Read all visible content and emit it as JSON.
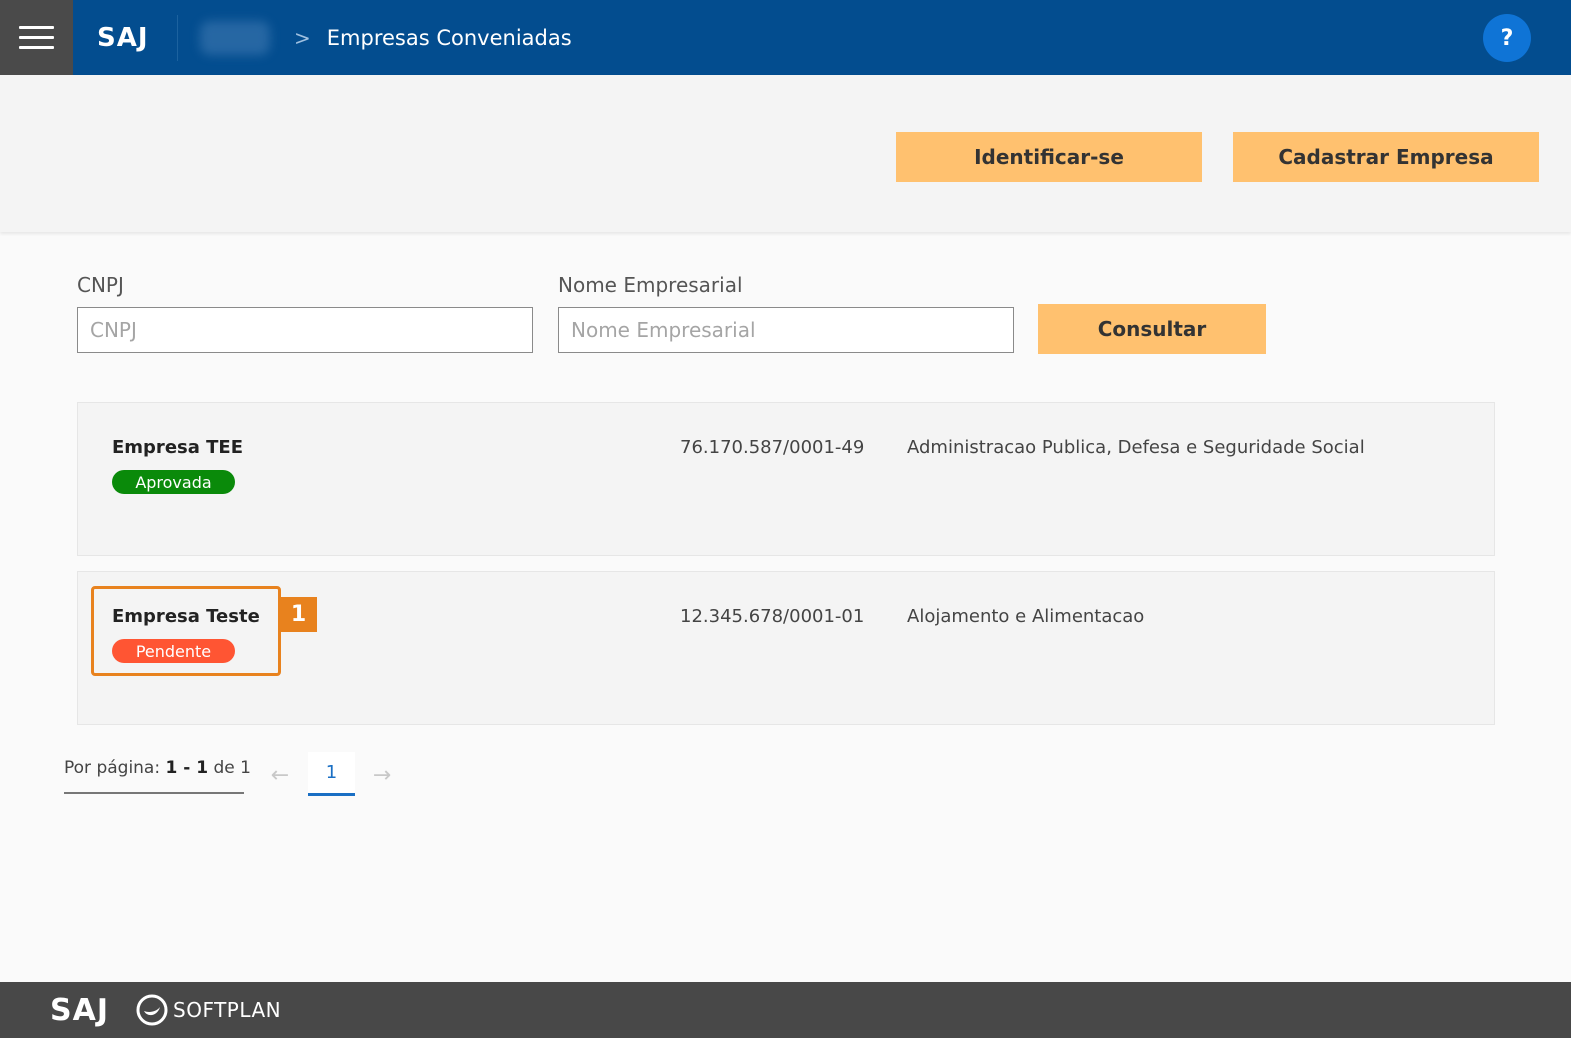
{
  "header": {
    "brand": "SAJ",
    "breadcrumb_separator": ">",
    "breadcrumb_current": "Empresas Conveniadas",
    "help_label": "?"
  },
  "actions": {
    "identify_label": "Identificar-se",
    "register_label": "Cadastrar Empresa"
  },
  "search": {
    "cnpj_label": "CNPJ",
    "cnpj_placeholder": "CNPJ",
    "name_label": "Nome Empresarial",
    "name_placeholder": "Nome Empresarial",
    "submit_label": "Consultar"
  },
  "results": [
    {
      "name": "Empresa TEE",
      "status": "Aprovada",
      "cnpj": "76.170.587/0001-49",
      "activity": "Administracao Publica, Defesa e Seguridade Social"
    },
    {
      "name": "Empresa Teste",
      "status": "Pendente",
      "cnpj": "12.345.678/0001-01",
      "activity": "Alojamento e Alimentacao"
    }
  ],
  "annotation": {
    "callout_number": "1"
  },
  "pagination": {
    "per_page_prefix": "Por página:",
    "range": "1 - 1",
    "of_label": "de",
    "total": "1",
    "current_page": "1",
    "prev_icon": "←",
    "next_icon": "→"
  },
  "footer": {
    "brand": "SAJ",
    "company": "SOFTPLAN"
  },
  "colors": {
    "header_blue": "#034d8f",
    "accent_amber": "#ffc16f",
    "approved_green": "#0a8a0a",
    "pending_red": "#ff5533",
    "annotation_orange": "#e8821e"
  }
}
